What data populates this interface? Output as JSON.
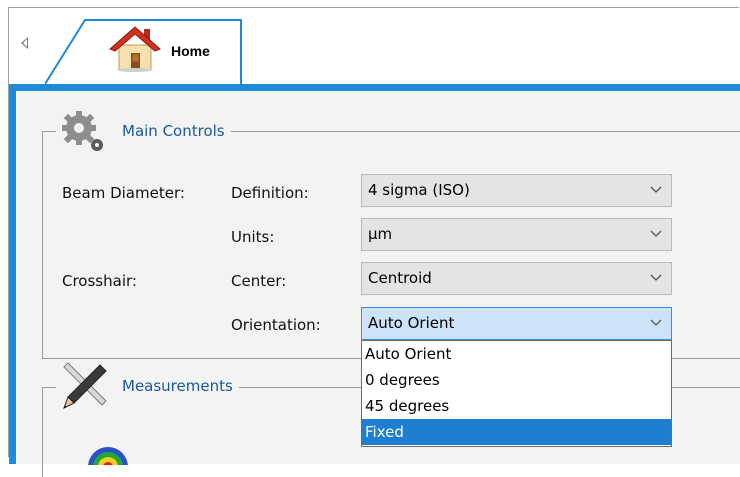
{
  "tabs": {
    "home_label": "Home"
  },
  "main_controls": {
    "title": "Main Controls",
    "beam_diameter_label": "Beam Diameter:",
    "definition_label": "Definition:",
    "definition_value": "4 sigma (ISO)",
    "units_label": "Units:",
    "units_value": "µm",
    "crosshair_label": "Crosshair:",
    "center_label": "Center:",
    "center_value": "Centroid",
    "orientation_label": "Orientation:",
    "orientation_value": "Auto Orient"
  },
  "orientation_dropdown": {
    "options": [
      "Auto Orient",
      "0 degrees",
      "45 degrees",
      "Fixed"
    ],
    "highlighted": "Fixed"
  },
  "measurements": {
    "title": "Measurements"
  },
  "colors": {
    "accent": "#1f8ad8",
    "group_title": "#1a5a9a",
    "selected_item": "#1e7fd1",
    "focused_combo": "#cde3f7"
  },
  "icons": {
    "scroll": "chevron-left-icon",
    "home": "house-icon",
    "main_controls": "gears-icon",
    "measurements": "pencil-ruler-icon",
    "combo": "chevron-down-icon",
    "bottom_partial": "target-icon"
  }
}
